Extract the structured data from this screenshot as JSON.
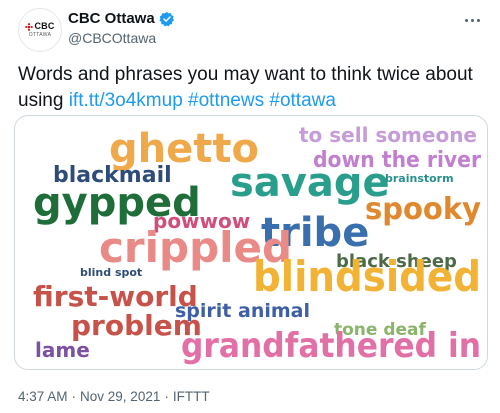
{
  "account": {
    "avatar_brand": "CBC",
    "avatar_sub": "OTTAWA",
    "display_name": "CBC Ottawa",
    "handle": "@CBCOttawa",
    "verified_color": "#1d9bf0"
  },
  "tweet": {
    "text_before": "Words and phrases you may want to think twice about using ",
    "link": "ift.tt/3o4kmup",
    "hashtags": [
      "#ottnews",
      "#ottawa"
    ],
    "link_color": "#1d9bf0"
  },
  "image": {
    "words": [
      {
        "text": "ghetto",
        "color": "#f0a94a"
      },
      {
        "text": "to sell someone",
        "color": "#c59bd8"
      },
      {
        "text": "down the river",
        "color": "#c27fcf"
      },
      {
        "text": "blackmail",
        "color": "#2e4c7a"
      },
      {
        "text": "savage",
        "color": "#2a9e8c"
      },
      {
        "text": "brainstorm",
        "color": "#2a8f8b"
      },
      {
        "text": "gypped",
        "color": "#1f6e3a"
      },
      {
        "text": "spooky",
        "color": "#e0882e"
      },
      {
        "text": "powwow",
        "color": "#d24e7a"
      },
      {
        "text": "tribe",
        "color": "#3a6fae"
      },
      {
        "text": "crippled",
        "color": "#e98a86"
      },
      {
        "text": "black sheep",
        "color": "#4d6a47"
      },
      {
        "text": "blind spot",
        "color": "#2e4c7a"
      },
      {
        "text": "blindsided",
        "color": "#f2b233"
      },
      {
        "text": "first-world",
        "color": "#c6524a"
      },
      {
        "text": "spirit animal",
        "color": "#3e5fa6"
      },
      {
        "text": "problem",
        "color": "#c6524a"
      },
      {
        "text": "tone deaf",
        "color": "#8ab46a"
      },
      {
        "text": "lame",
        "color": "#7c51a1"
      },
      {
        "text": "grandfathered in",
        "color": "#e26fa6"
      }
    ]
  },
  "meta": {
    "time": "4:37 AM",
    "separator": "·",
    "date": "Nov 29, 2021",
    "source": "IFTTT"
  }
}
